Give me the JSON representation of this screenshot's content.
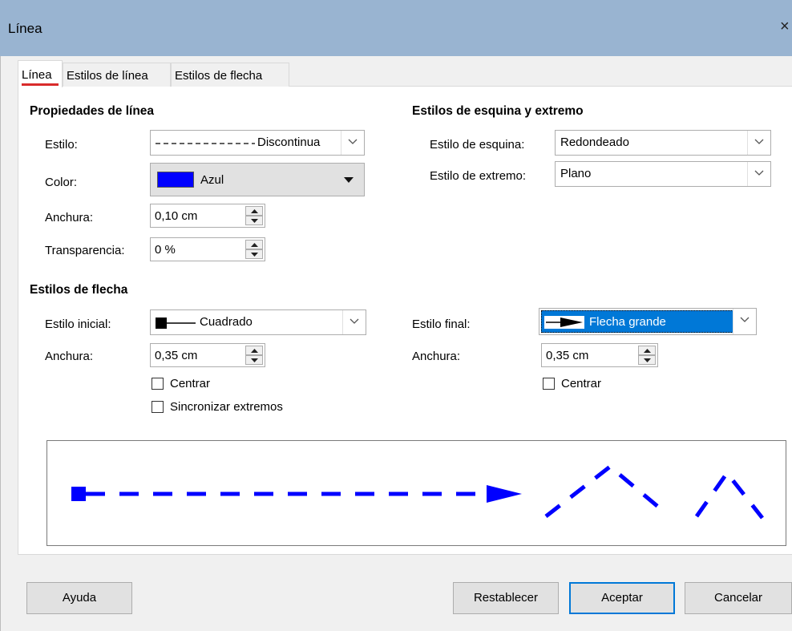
{
  "window": {
    "title": "Línea",
    "close_glyph": "×"
  },
  "tabs": [
    {
      "label": "Línea",
      "active": true
    },
    {
      "label": "Estilos de línea",
      "active": false
    },
    {
      "label": "Estilos de flecha",
      "active": false
    }
  ],
  "line_properties": {
    "heading": "Propiedades de línea",
    "style": {
      "label": "Estilo:",
      "value": "Discontinua",
      "pattern": "dashed"
    },
    "color": {
      "label": "Color:",
      "value": "Azul",
      "swatch": "#0000ff"
    },
    "width": {
      "label": "Anchura:",
      "value": "0,10 cm"
    },
    "transparency": {
      "label": "Transparencia:",
      "value": "0 %"
    }
  },
  "corner_cap": {
    "heading": "Estilos de esquina y extremo",
    "corner_style": {
      "label": "Estilo de esquina:",
      "value": "Redondeado"
    },
    "cap_style": {
      "label": "Estilo de extremo:",
      "value": "Plano"
    }
  },
  "arrow_styles": {
    "heading": "Estilos de flecha",
    "start": {
      "label": "Estilo inicial:",
      "value": "Cuadrado",
      "icon": "square-arrow-icon"
    },
    "start_width": {
      "label": "Anchura:",
      "value": "0,35 cm"
    },
    "start_center": {
      "label": "Centrar",
      "checked": false
    },
    "sync_ends": {
      "label": "Sincronizar extremos",
      "checked": false
    },
    "end": {
      "label": "Estilo final:",
      "value": "Flecha grande",
      "icon": "large-arrow-icon",
      "selected": true
    },
    "end_width": {
      "label": "Anchura:",
      "value": "0,35 cm"
    },
    "end_center": {
      "label": "Centrar",
      "checked": false
    }
  },
  "preview": {
    "line_color": "#0000ff"
  },
  "buttons": {
    "help": "Ayuda",
    "reset": "Restablecer",
    "ok": "Aceptar",
    "cancel": "Cancelar"
  },
  "colors": {
    "titlebar": "#99b4d1",
    "accent": "#0078d7",
    "tab_underline": "#d92b2b"
  }
}
